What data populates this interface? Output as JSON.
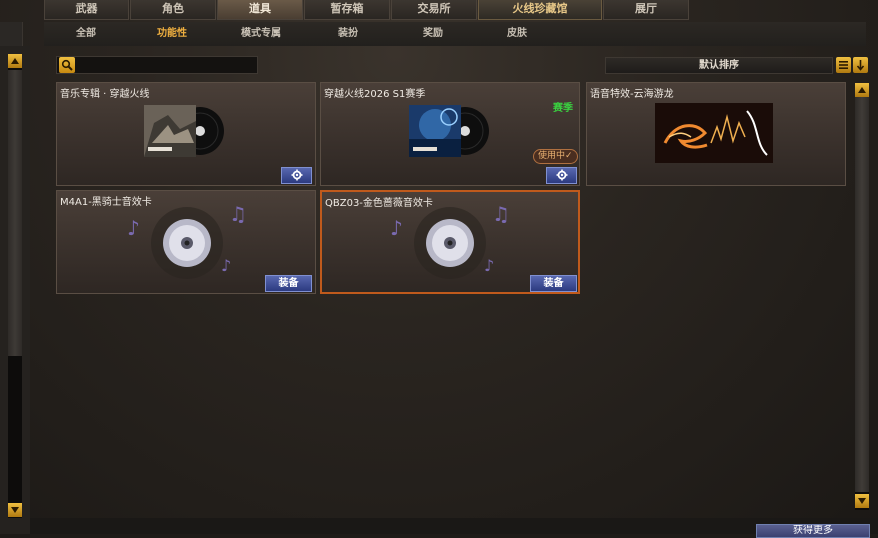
{
  "top_tabs": [
    {
      "label": "武器"
    },
    {
      "label": "角色"
    },
    {
      "label": "道具"
    },
    {
      "label": "暂存箱"
    },
    {
      "label": "交易所"
    },
    {
      "label": "火线珍藏馆"
    },
    {
      "label": "展厅"
    }
  ],
  "sub_tabs": [
    {
      "label": "全部"
    },
    {
      "label": "功能性"
    },
    {
      "label": "模式专属"
    },
    {
      "label": "装扮"
    },
    {
      "label": "奖励"
    },
    {
      "label": "皮肤"
    }
  ],
  "search": {
    "placeholder": ""
  },
  "sort": {
    "label": "默认排序"
  },
  "cards": [
    {
      "title": "音乐专辑 · 穿越火线",
      "button_icon": "gear-icon"
    },
    {
      "title": "穿越火线2026 S1赛季",
      "badge": "赛季",
      "status": "使用中✓",
      "button_icon": "gear-icon"
    },
    {
      "title": "语音特效-云海游龙"
    },
    {
      "title": "M4A1-黑骑士音效卡",
      "button_label": "装备"
    },
    {
      "title": "QBZ03-金色蔷薇音效卡",
      "button_label": "装备"
    }
  ],
  "bottom": {
    "button_label": "获得更多"
  },
  "colors": {
    "accent": "#f0b040",
    "selected_border": "#c05a1c",
    "season_green": "#3ad040",
    "button_blue": "#3c4a90"
  }
}
